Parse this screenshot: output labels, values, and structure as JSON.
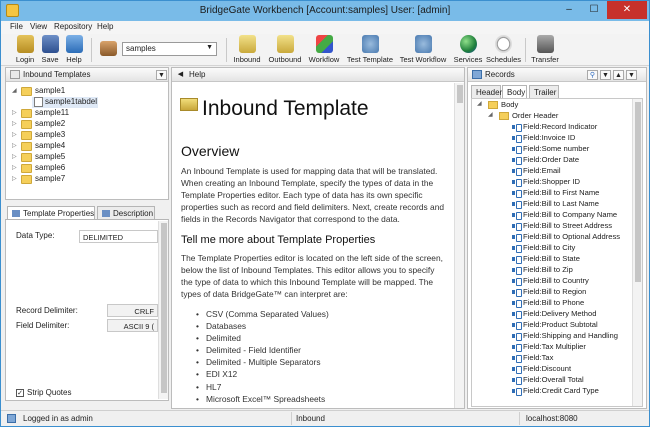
{
  "window": {
    "title": "BridgeGate Workbench [Account:samples] User: [admin]",
    "controls": {
      "minimize": "–",
      "maximize": "☐",
      "close": "✕"
    }
  },
  "menu": [
    "File",
    "View",
    "Repository",
    "Help"
  ],
  "toolbar": {
    "login": "Login",
    "save": "Save",
    "help": "Help",
    "account_value": "samples",
    "buttons": [
      "Inbound",
      "Outbound",
      "Workflow",
      "Test Template",
      "Test Workflow",
      "Services",
      "Schedules",
      "Transfer"
    ]
  },
  "inbound_panel": {
    "title": "Inbound Templates",
    "items": [
      {
        "label": "sample1",
        "expanded": true
      },
      {
        "label": "sample1tabdel",
        "child": true
      },
      {
        "label": "sample11"
      },
      {
        "label": "sample2"
      },
      {
        "label": "sample3"
      },
      {
        "label": "sample4"
      },
      {
        "label": "sample5"
      },
      {
        "label": "sample6"
      },
      {
        "label": "sample7"
      }
    ]
  },
  "properties_panel": {
    "tabs": [
      "Template Properties",
      "Description"
    ],
    "data_type_label": "Data Type:",
    "data_type_value": "DELIMITED",
    "record_delim_label": "Record Delimiter:",
    "record_delim_value": "CRLF",
    "field_delim_label": "Field Delimiter:",
    "field_delim_value": "ASCII 9 (",
    "strip_quotes_label": "Strip Quotes",
    "strip_quotes_checked": true
  },
  "help_panel": {
    "header": "Help",
    "title": "Inbound Template",
    "overview_heading": "Overview",
    "overview_lines": [
      "An Inbound Template is used for mapping data that will be translated.",
      "When creating an Inbound Template, specify the types of data in the",
      "Template Properties editor. Each type of data has its own specific",
      "properties such as record and field delimiters. Next, create records and",
      "fields in the Records Navigator that correspond to the data."
    ],
    "more_heading": "Tell me more about Template Properties",
    "more_lines": [
      "The Template Properties editor is located on the left side of the screen,",
      "below the list of Inbound Templates. This editor allows you to specify",
      "the type of data to which this Inbound Template will be mapped. The",
      "types of data BridgeGate™ can interpret are:"
    ],
    "bullets": [
      "CSV (Comma Separated Values)",
      "Databases",
      "Delimited",
      "Delimited - Field Identifier",
      "Delimited - Multiple Separators",
      "EDI X12",
      "HL7",
      "Microsoft Excel™ Spreadsheets"
    ]
  },
  "records_panel": {
    "title": "Records",
    "tabs": [
      "Header",
      "Body",
      "Trailer"
    ],
    "active_tab": "Body",
    "root": "Body",
    "group": "Order Header",
    "fields": [
      "Field:Record Indicator",
      "Field:Invoice ID",
      "Field:Some number",
      "Field:Order Date",
      "Field:Email",
      "Field:Shopper ID",
      "Field:Bill to First Name",
      "Field:Bill to Last Name",
      "Field:Bill to Company Name",
      "Field:Bill to Street Address",
      "Field:Bill to Optional Address",
      "Field:Bill to City",
      "Field:Bill to State",
      "Field:Bill to Zip",
      "Field:Bill to Country",
      "Field:Bill to Region",
      "Field:Bill to Phone",
      "Field:Delivery Method",
      "Field:Product Subtotal",
      "Field:Shipping and Handling",
      "Field:Tax Multiplier",
      "Field:Tax",
      "Field:Discount",
      "Field:Overall Total",
      "Field:Credit Card Type"
    ]
  },
  "status": {
    "left": "Logged in as admin",
    "middle": "Inbound",
    "right": "localhost:8080"
  },
  "colors": {
    "titlebar": "#79bbe8",
    "close": "#c7312b",
    "folder": "#f5cf5a",
    "field_icon": "#2f6db5"
  }
}
